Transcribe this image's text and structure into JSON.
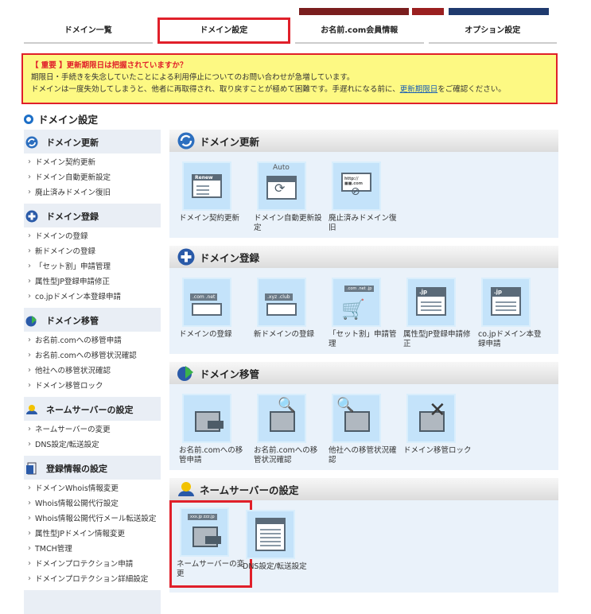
{
  "tabs": [
    {
      "label": "ドメイン一覧"
    },
    {
      "label": "ドメイン設定"
    },
    {
      "label": "お名前.com会員情報"
    },
    {
      "label": "オプション設定"
    }
  ],
  "alert": {
    "title": "【 重要 】更新期限日は把握されていますか？",
    "line1": "期限日・手続きを失念していたことによる利用停止についてのお問い合わせが急増しています。",
    "line2_pre": "ドメインは一度失効してしまうと、他者に再取得され、取り戻すことが極めて困難です。手遅れになる前に、",
    "line2_link": "更新期限日",
    "line2_post": "をご確認ください。"
  },
  "page_title": "ドメイン設定",
  "sidebar": {
    "sections": [
      {
        "title": "ドメイン更新",
        "icon": "refresh-icon",
        "items": [
          "ドメイン契約更新",
          "ドメイン自動更新設定",
          "廃止済みドメイン復旧"
        ]
      },
      {
        "title": "ドメイン登録",
        "icon": "plus-icon",
        "items": [
          "ドメインの登録",
          "新ドメインの登録",
          "「セット割」申請管理",
          "属性型JP登録申請修正",
          "co.jpドメイン本登録申請"
        ]
      },
      {
        "title": "ドメイン移管",
        "icon": "transfer-icon",
        "items": [
          "お名前.comへの移管申請",
          "お名前.comへの移管状況確認",
          "他社への移管状況確認",
          "ドメイン移管ロック"
        ]
      },
      {
        "title": "ネームサーバーの設定",
        "icon": "nameserver-icon",
        "items": [
          "ネームサーバーの変更",
          "DNS設定/転送設定"
        ]
      },
      {
        "title": "登録情報の設定",
        "icon": "registration-icon",
        "items": [
          "ドメインWhois情報変更",
          "Whois情報公開代行設定",
          "Whois情報公開代行メール転送設定",
          "属性型JPドメイン情報変更",
          "TMCH管理",
          "ドメインプロテクション申請",
          "ドメインプロテクション詳細設定"
        ]
      }
    ]
  },
  "panels": [
    {
      "title": "ドメイン更新",
      "tiles": [
        {
          "label": "ドメイン契約更新",
          "icon": "renew-doc-icon",
          "icon_text": "Renew"
        },
        {
          "label": "ドメイン自動更新設定",
          "icon": "auto-renew-icon",
          "icon_text": "Auto"
        },
        {
          "label": "廃止済みドメイン復旧",
          "icon": "restore-domain-icon",
          "icon_text": "http://■■.com"
        }
      ]
    },
    {
      "title": "ドメイン登録",
      "tiles": [
        {
          "label": "ドメインの登録",
          "icon": "register-domain-icon",
          "icon_text": ".com .net"
        },
        {
          "label": "新ドメインの登録",
          "icon": "new-domain-icon",
          "icon_text": ".xyz .club"
        },
        {
          "label": "「セット割」申請管理",
          "icon": "cart-icon",
          "icon_text": ".com .net .jp"
        },
        {
          "label": "属性型JP登録申請修正",
          "icon": "jp-domain-icon",
          "icon_text": ".jp"
        },
        {
          "label": "co.jpドメイン本登録申請",
          "icon": "cojp-domain-icon",
          "icon_text": ".jp"
        }
      ]
    },
    {
      "title": "ドメイン移管",
      "tiles": [
        {
          "label": "お名前.comへの移管申請",
          "icon": "transfer-in-icon"
        },
        {
          "label": "お名前.comへの移管状況確認",
          "icon": "transfer-status-icon"
        },
        {
          "label": "他社への移管状況確認",
          "icon": "transfer-out-icon"
        },
        {
          "label": "ドメイン移管ロック",
          "icon": "transfer-lock-icon"
        }
      ]
    },
    {
      "title": "ネームサーバーの設定",
      "tiles": [
        {
          "label": "ネームサーバーの変更",
          "icon": "change-nameserver-icon",
          "icon_text": "xxx.jp zzz.jp"
        },
        {
          "label": "DNS設定/転送設定",
          "icon": "dns-settings-icon"
        }
      ]
    }
  ]
}
